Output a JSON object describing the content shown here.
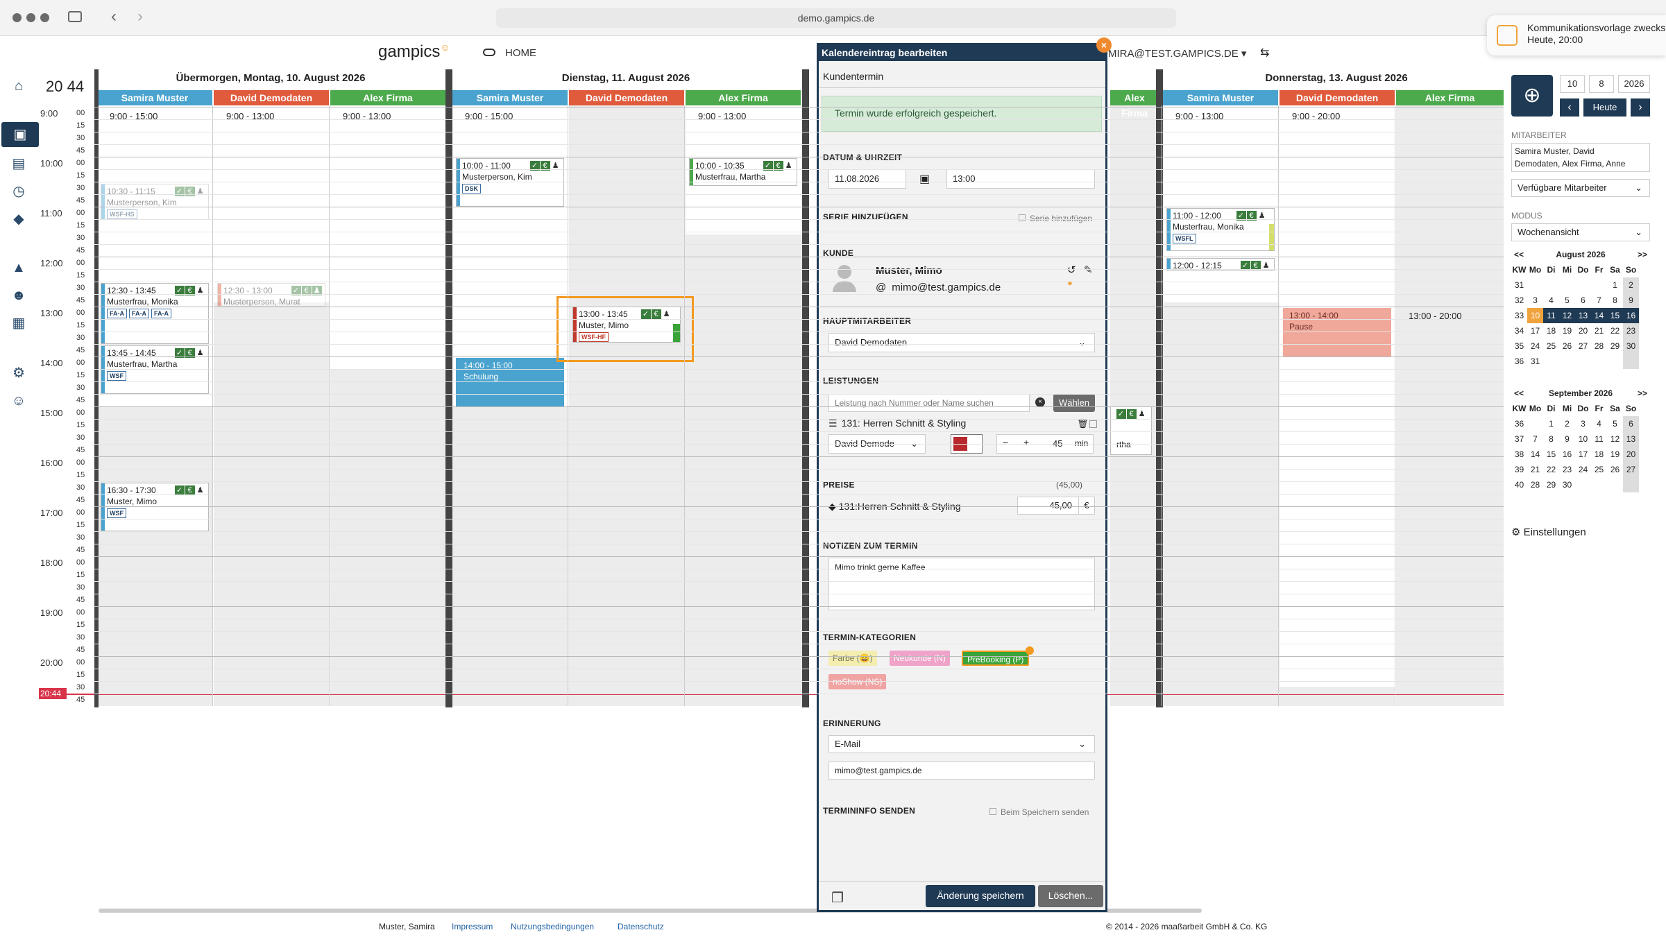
{
  "browser": {
    "url": "demo.gampics.de"
  },
  "notification": {
    "title": "Kommunikationsvorlage zwecks",
    "subtitle": "Heute, 20:00"
  },
  "header": {
    "logo": "gampics",
    "home": "HOME",
    "user": "MIRA@TEST.GAMPICS.DE"
  },
  "clock": "20 44",
  "days": [
    {
      "title": "Übermorgen, Montag, 10. August 2026",
      "staff": [
        "Samira Muster",
        "David Demodaten",
        "Alex Firma"
      ],
      "hours": [
        "9:00 - 15:00",
        "9:00 - 13:00",
        "9:00 - 13:00"
      ]
    },
    {
      "title": "Dienstag, 11. August 2026",
      "staff": [
        "Samira Muster",
        "David Demodaten",
        "Alex Firma"
      ],
      "hours": [
        "9:00 - 15:00",
        "",
        "9:00 - 13:00"
      ]
    },
    {
      "title": "Donnerstag, 13. August 2026",
      "staff": [
        "Samira Muster",
        "David Demodaten",
        "Alex Firma"
      ],
      "hours": [
        "9:00 - 13:00",
        "9:00 - 20:00",
        ""
      ]
    }
  ],
  "time_labels": [
    "9:00",
    "10:00",
    "11:00",
    "12:00",
    "13:00",
    "14:00",
    "15:00",
    "16:00",
    "17:00",
    "18:00",
    "19:00",
    "20:00"
  ],
  "minute_labels": [
    "00",
    "15",
    "30",
    "45"
  ],
  "now_label": "20:44",
  "appointments": {
    "a1": {
      "time": "10:30 - 11:15",
      "name": "Musterperson, Kim",
      "tag": "WSF-HS"
    },
    "a2": {
      "time": "12:30 - 13:45",
      "name": "Musterfrau, Monika",
      "tags": [
        "FA-A",
        "FA-A",
        "FA-A"
      ]
    },
    "a3": {
      "time": "12:30 - 13:00",
      "name": "Musterperson, Murat"
    },
    "a4": {
      "time": "13:45 - 14:45",
      "name": "Musterfrau, Martha",
      "tag": "WSF"
    },
    "a5": {
      "time": "16:30 - 17:30",
      "name": "Muster, Mimo",
      "tag": "WSF"
    },
    "a6": {
      "time": "10:00 - 11:00",
      "name": "Musterperson, Kim",
      "tag": "DSK"
    },
    "a7": {
      "time": "10:00 - 10:35",
      "name": "Musterfrau, Martha"
    },
    "a8": {
      "time": "14:00 - 15:00",
      "name": "Schulung"
    },
    "a9": {
      "time": "13:00 - 13:45",
      "name": "Muster, Mimo",
      "tag": "WSF-HF"
    },
    "a10": {
      "time": "11:00 - 12:00",
      "name": "Musterfrau, Monika",
      "tag": "WSFL"
    },
    "a11": {
      "time": "12:00 - 12:15"
    },
    "a12": {
      "time": "13:00 - 14:00",
      "name": "Pause"
    },
    "a13": {
      "time": "13:00 - 20:00"
    },
    "a14": {
      "name": "rtha"
    }
  },
  "modal": {
    "title": "Kalendereintrag bearbeiten",
    "subtitle": "Kundentermin",
    "success": "Termin wurde erfolgreich gespeichert.",
    "date_section": "DATUM & UHRZEIT",
    "date": "11.08.2026",
    "time": "13:00",
    "series_section": "SERIE HINZUFÜGEN",
    "series_check": "Serie hinzufügen",
    "customer_section": "KUNDE",
    "customer_name": "Muster, Mimo",
    "customer_email": "mimo@test.gampics.de",
    "employee_section": "HAUPTMITARBEITER",
    "employee": "David Demodaten",
    "services_section": "LEISTUNGEN",
    "service_placeholder": "Leistung nach Nummer oder Name suchen",
    "choose": "Wählen",
    "service_name": "131: Herren Schnitt & Styling",
    "service_employee": "David Demode",
    "duration": "45",
    "duration_unit": "min",
    "prices_section": "PREISE",
    "prices_total": "(45,00)",
    "price_item": "131:Herren Schnitt & Styling",
    "price_value": "45,00",
    "currency": "€",
    "notes_section": "NOTIZEN ZUM TERMIN",
    "notes": "Mimo trinkt gerne Kaffee",
    "categories_section": "TERMIN-KATEGORIEN",
    "categories": [
      "Farbe (😀)",
      "Neukunde (N)",
      "PreBooking (P)",
      "noShow (NS)"
    ],
    "reminder_section": "ERINNERUNG",
    "reminder_type": "E-Mail",
    "reminder_email": "mimo@test.gampics.de",
    "send_section": "TERMININFO SENDEN",
    "send_check": "Beim Speichern senden",
    "save": "Änderung speichern",
    "delete": "Löschen..."
  },
  "right": {
    "day": "10",
    "month": "8",
    "year": "2026",
    "today": "Heute",
    "staff_label": "MITARBEITER",
    "staff_value": "Samira Muster, David Demodaten, Alex Firma, Anne",
    "available": "Verfügbare Mitarbeiter",
    "mode_label": "MODUS",
    "mode": "Wochenansicht",
    "settings": "Einstellungen"
  },
  "mini_aug": {
    "title": "August 2026",
    "prev": "<<",
    "next": ">>",
    "head": [
      "KW",
      "Mo",
      "Di",
      "Mi",
      "Do",
      "Fr",
      "Sa",
      "So"
    ],
    "rows": [
      [
        "31",
        "",
        "",
        "",
        "",
        "",
        "1",
        "2"
      ],
      [
        "32",
        "3",
        "4",
        "5",
        "6",
        "7",
        "8",
        "9"
      ],
      [
        "33",
        "10",
        "11",
        "12",
        "13",
        "14",
        "15",
        "16"
      ],
      [
        "34",
        "17",
        "18",
        "19",
        "20",
        "21",
        "22",
        "23"
      ],
      [
        "35",
        "24",
        "25",
        "26",
        "27",
        "28",
        "29",
        "30"
      ],
      [
        "36",
        "31",
        "",
        "",
        "",
        "",
        "",
        ""
      ]
    ]
  },
  "mini_sep": {
    "title": "September 2026",
    "prev": "<<",
    "next": ">>",
    "head": [
      "KW",
      "Mo",
      "Di",
      "Mi",
      "Do",
      "Fr",
      "Sa",
      "So"
    ],
    "rows": [
      [
        "36",
        "",
        "1",
        "2",
        "3",
        "4",
        "5",
        "6"
      ],
      [
        "37",
        "7",
        "8",
        "9",
        "10",
        "11",
        "12",
        "13"
      ],
      [
        "38",
        "14",
        "15",
        "16",
        "17",
        "18",
        "19",
        "20"
      ],
      [
        "39",
        "21",
        "22",
        "23",
        "24",
        "25",
        "26",
        "27"
      ],
      [
        "40",
        "28",
        "29",
        "30",
        "",
        "",
        "",
        ""
      ]
    ]
  },
  "footer": {
    "user": "Muster, Samira",
    "impressum": "Impressum",
    "terms": "Nutzungsbedingungen",
    "privacy": "Datenschutz",
    "copyright": "© 2014 - 2026 maaßarbeit GmbH & Co. KG"
  },
  "colors": {
    "navy": "#1f3a55",
    "staff_blue": "#4aa3cf",
    "staff_red": "#e05a3c",
    "staff_green": "#4caa4c",
    "highlight": "#f39a1e"
  }
}
